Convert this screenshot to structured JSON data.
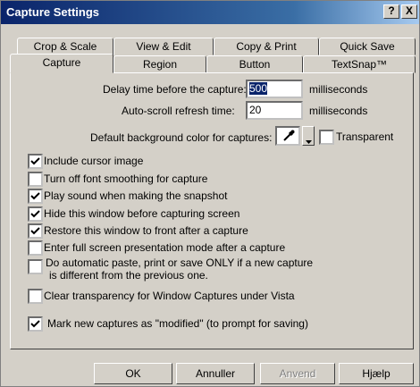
{
  "window": {
    "title": "Capture Settings",
    "help_label": "?",
    "close_label": "X"
  },
  "tabs_back": [
    "Crop & Scale",
    "View & Edit",
    "Copy & Print",
    "Quick Save"
  ],
  "tabs_front": [
    "Capture",
    "Region",
    "Button",
    "TextSnap™"
  ],
  "active_tab": "Capture",
  "delay": {
    "label": "Delay time before the capture:",
    "value": "500",
    "unit": "milliseconds"
  },
  "autoscroll": {
    "label": "Auto-scroll refresh time:",
    "value": "20",
    "unit": "milliseconds"
  },
  "background": {
    "label": "Default background color for captures:",
    "transparent_label": "Transparent",
    "transparent_checked": false,
    "icon": "eyedropper-icon"
  },
  "checkboxes": [
    {
      "label": "Include cursor image",
      "checked": true
    },
    {
      "label": "Turn off font smoothing for capture",
      "checked": false
    },
    {
      "label": "Play sound when making the snapshot",
      "checked": true
    },
    {
      "label": "Hide this window before capturing screen",
      "checked": true
    },
    {
      "label": "Restore this window to front after a capture",
      "checked": true
    },
    {
      "label": "Enter full screen presentation mode after a capture",
      "checked": false
    },
    {
      "label_line1": "Do automatic paste, print or save ONLY if a new capture",
      "label_line2": "is different from the previous one.",
      "checked": false
    },
    {
      "label": "Clear transparency for Window Captures under Vista",
      "checked": false
    },
    {
      "label": "Mark new captures as \"modified\" (to prompt for saving)",
      "checked": true
    }
  ],
  "buttons": {
    "ok": "OK",
    "cancel": "Annuller",
    "apply": "Anvend",
    "help": "Hjælp"
  }
}
